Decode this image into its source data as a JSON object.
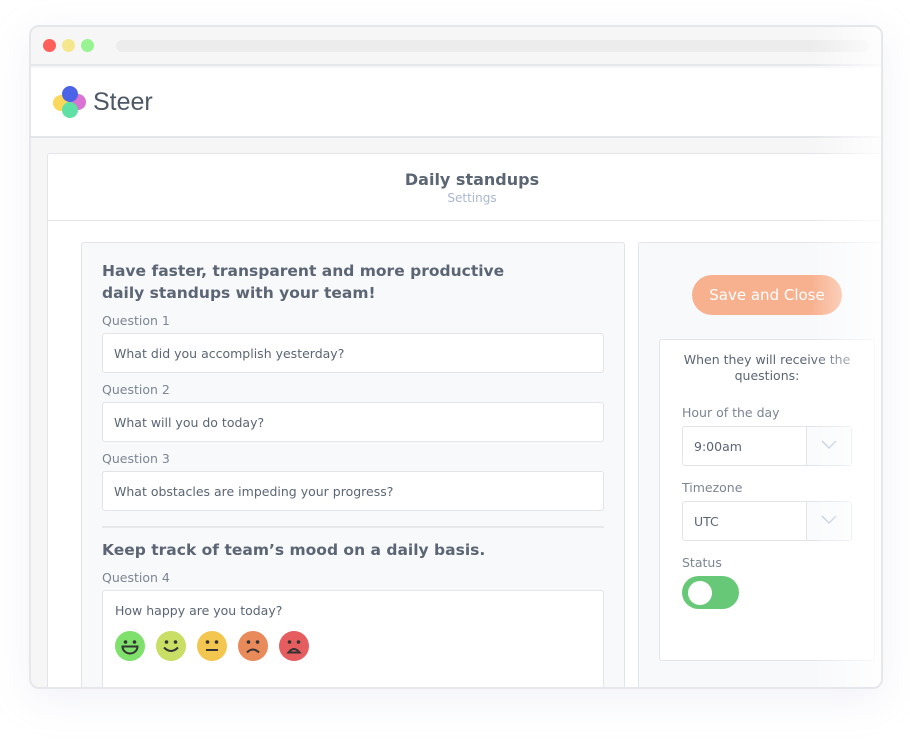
{
  "window": {
    "traffic_lights": [
      "close",
      "minimize",
      "maximize"
    ]
  },
  "header": {
    "brand": "Steer",
    "logo_icon": "steer-logo-icon"
  },
  "page": {
    "title": "Daily standups",
    "subtitle": "Settings"
  },
  "questions_section": {
    "intro": "Have faster, transparent and more productive daily standups with your team!",
    "questions": [
      {
        "label": "Question 1",
        "value": "What did you accomplish yesterday?"
      },
      {
        "label": "Question 2",
        "value": "What will you do today?"
      },
      {
        "label": "Question 3",
        "value": "What obstacles are impeding your progress?"
      }
    ]
  },
  "mood_section": {
    "title": "Keep track of team’s mood on a daily basis.",
    "label": "Question 4",
    "question": "How happy are you today?",
    "faces": [
      {
        "name": "very-happy-face-icon",
        "color": "#7fe06b"
      },
      {
        "name": "happy-face-icon",
        "color": "#c8de64"
      },
      {
        "name": "neutral-face-icon",
        "color": "#f3c64f"
      },
      {
        "name": "sad-face-icon",
        "color": "#e88a5a"
      },
      {
        "name": "very-sad-face-icon",
        "color": "#e55d5e"
      }
    ]
  },
  "sidebar": {
    "save_label": "Save and Close",
    "schedule_title": "When they will receive the questions:",
    "hour_label": "Hour of the day",
    "hour_value": "9:00am",
    "timezone_label": "Timezone",
    "timezone_value": "UTC",
    "status_label": "Status",
    "status_on": true
  },
  "colors": {
    "accent": "#f8b18f",
    "toggle": "#67c978",
    "text": "#5b6573"
  }
}
